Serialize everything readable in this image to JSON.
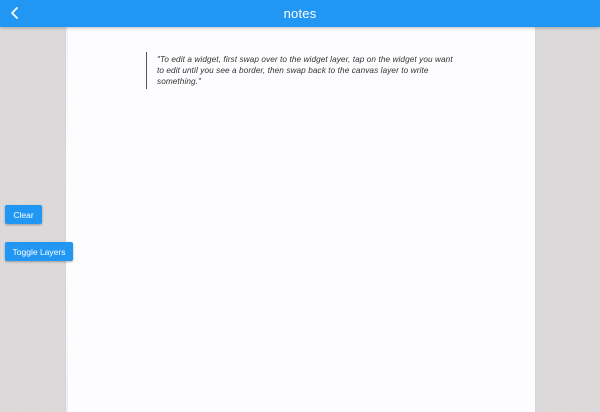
{
  "app_bar": {
    "title": "notes",
    "back_icon": "chevron-left-icon",
    "color": "#2196f3"
  },
  "canvas": {
    "quote": "\"To edit a widget, first swap over to the widget layer, tap on the widget you want to edit until you see a border, then swap back to the canvas layer to write something.\""
  },
  "controls": {
    "clear_label": "Clear",
    "toggle_layers_label": "Toggle Layers"
  }
}
